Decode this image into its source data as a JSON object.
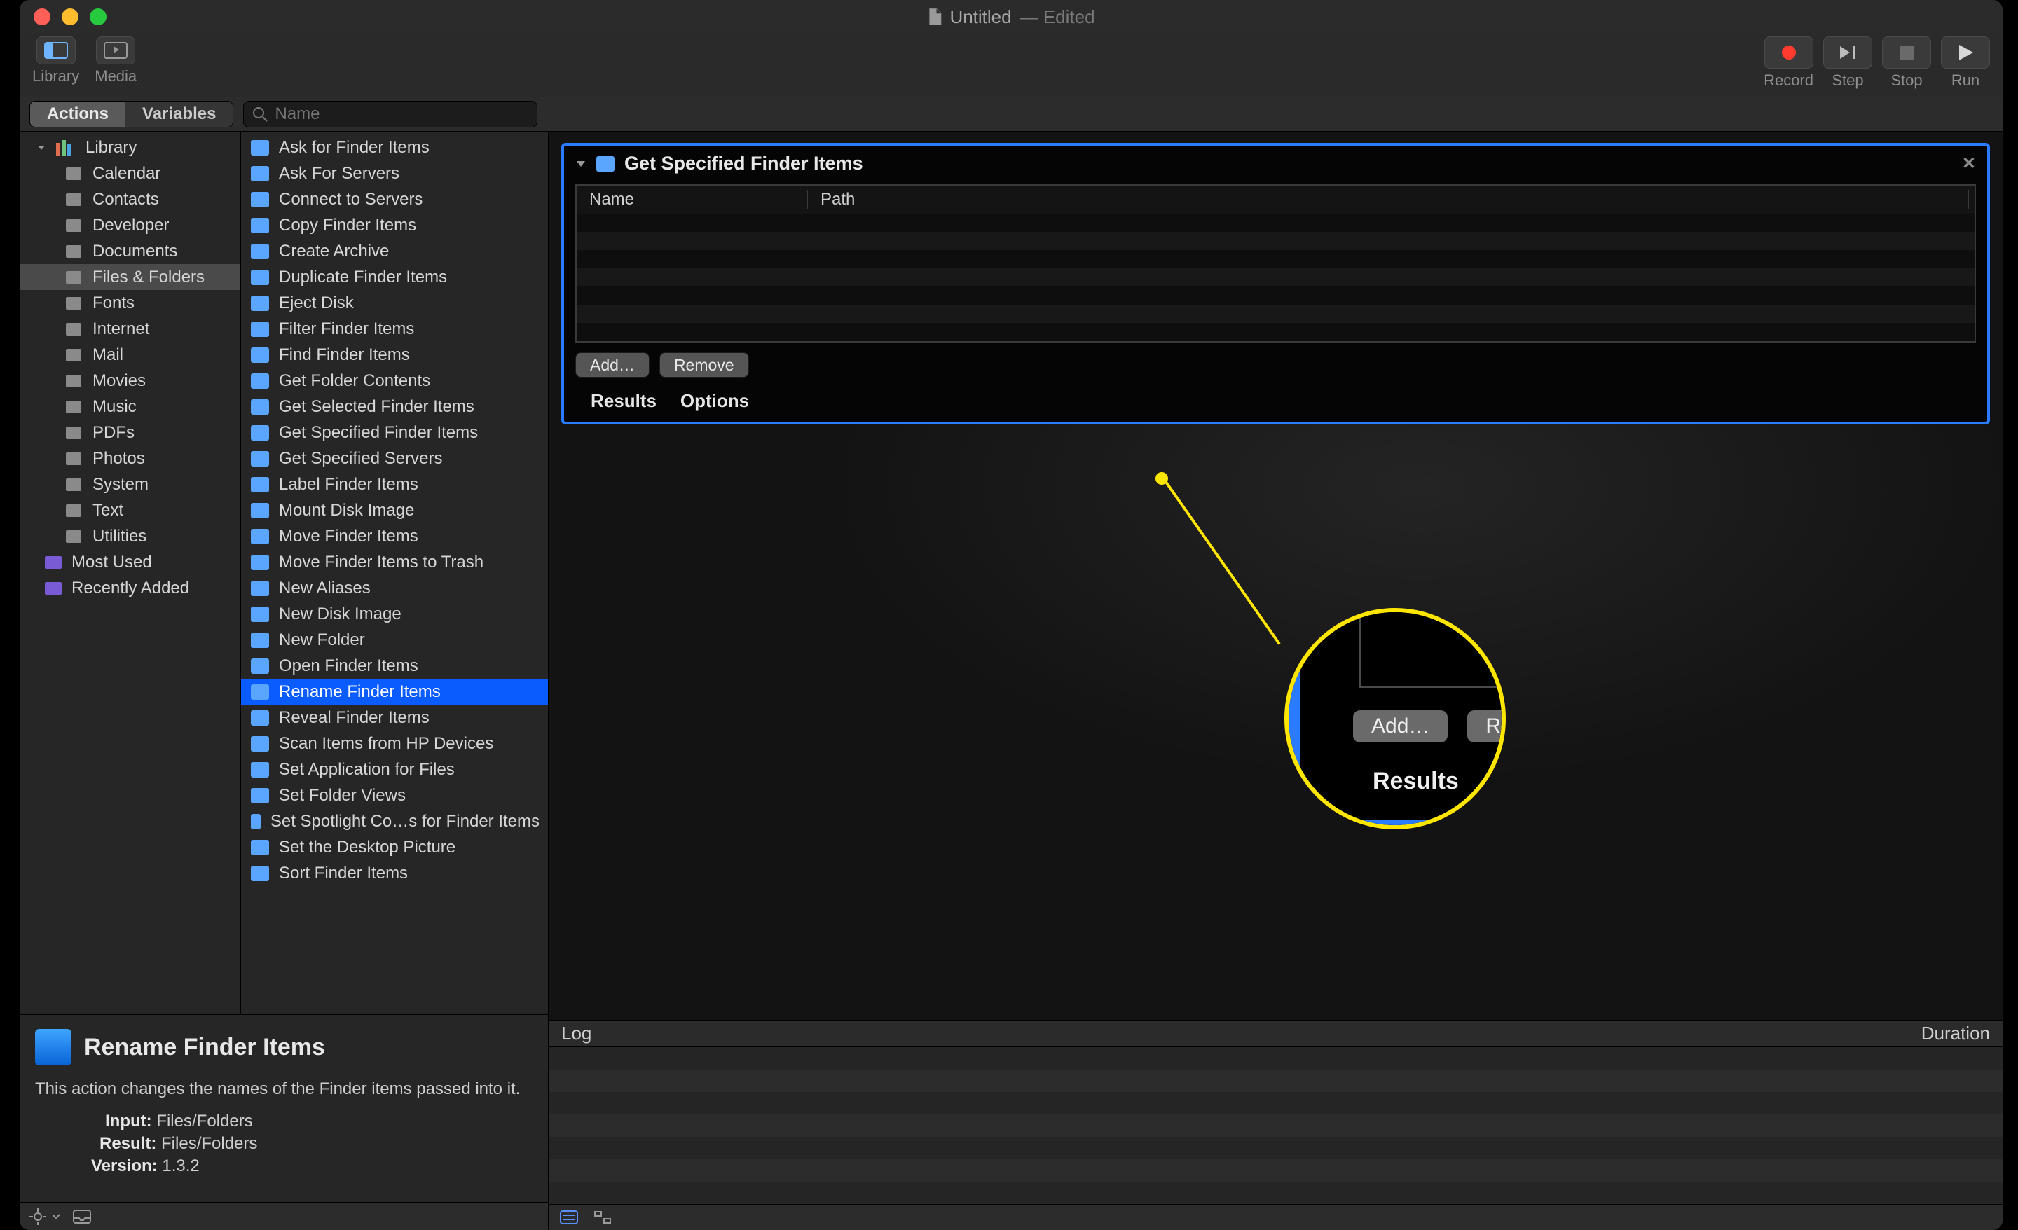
{
  "window": {
    "title": "Untitled",
    "status": "Edited"
  },
  "toolbar": {
    "library": "Library",
    "media": "Media",
    "record": "Record",
    "step": "Step",
    "stop": "Stop",
    "run": "Run"
  },
  "tabs": {
    "actions": "Actions",
    "variables": "Variables"
  },
  "search": {
    "placeholder": "Name"
  },
  "library": {
    "root": "Library",
    "categories": [
      "Calendar",
      "Contacts",
      "Developer",
      "Documents",
      "Files & Folders",
      "Fonts",
      "Internet",
      "Mail",
      "Movies",
      "Music",
      "PDFs",
      "Photos",
      "System",
      "Text",
      "Utilities"
    ],
    "selected_category": "Files & Folders",
    "extras": [
      "Most Used",
      "Recently Added"
    ]
  },
  "actions": {
    "items": [
      "Ask for Finder Items",
      "Ask For Servers",
      "Connect to Servers",
      "Copy Finder Items",
      "Create Archive",
      "Duplicate Finder Items",
      "Eject Disk",
      "Filter Finder Items",
      "Find Finder Items",
      "Get Folder Contents",
      "Get Selected Finder Items",
      "Get Specified Finder Items",
      "Get Specified Servers",
      "Label Finder Items",
      "Mount Disk Image",
      "Move Finder Items",
      "Move Finder Items to Trash",
      "New Aliases",
      "New Disk Image",
      "New Folder",
      "Open Finder Items",
      "Rename Finder Items",
      "Reveal Finder Items",
      "Scan Items from HP Devices",
      "Set Application for Files",
      "Set Folder Views",
      "Set Spotlight Co…s for Finder Items",
      "Set the Desktop Picture",
      "Sort Finder Items"
    ],
    "selected": "Rename Finder Items"
  },
  "detail": {
    "title": "Rename Finder Items",
    "description": "This action changes the names of the Finder items passed into it.",
    "input_label": "Input:",
    "input_value": "Files/Folders",
    "result_label": "Result:",
    "result_value": "Files/Folders",
    "version_label": "Version:",
    "version_value": "1.3.2"
  },
  "workflow": {
    "action_title": "Get Specified Finder Items",
    "columns": {
      "name": "Name",
      "path": "Path"
    },
    "add": "Add…",
    "remove": "Remove",
    "results": "Results",
    "options": "Options"
  },
  "log": {
    "log": "Log",
    "duration": "Duration"
  },
  "magnify": {
    "add": "Add…",
    "remove_partial": "Re",
    "results": "Results"
  }
}
